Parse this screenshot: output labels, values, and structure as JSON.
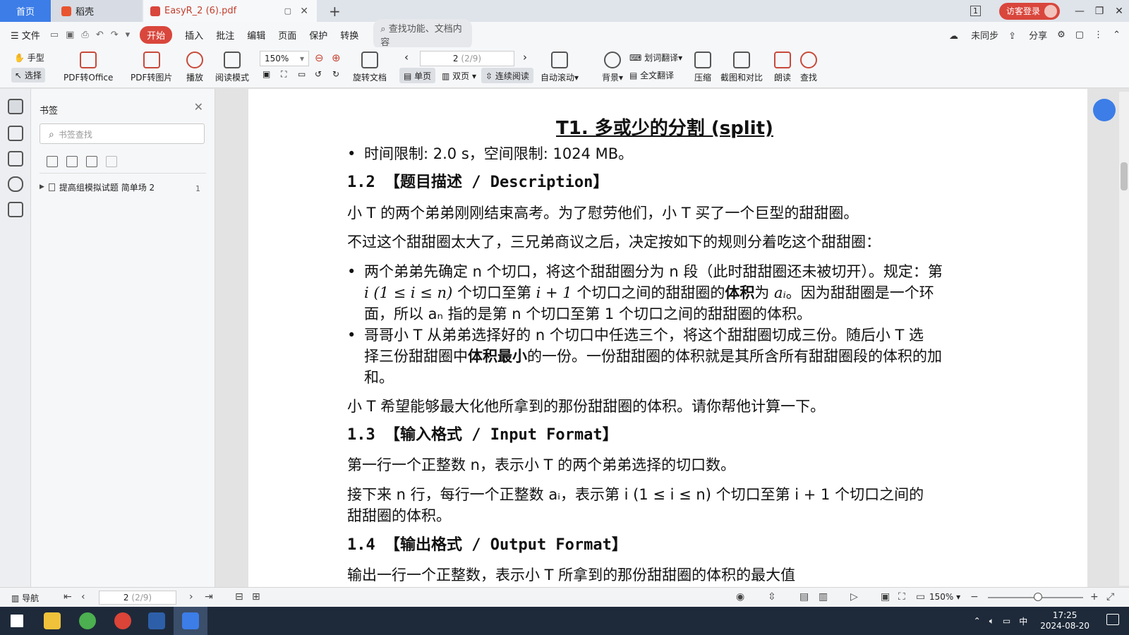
{
  "tabs": {
    "home": "首页",
    "daoke": "稻壳",
    "pdf": "EasyR_2 (6).pdf",
    "new_tab": "+"
  },
  "window": {
    "tab_count": "1",
    "login": "访客登录",
    "minimize": "—",
    "restore": "❐",
    "close": "✕"
  },
  "menu": {
    "file": "文件",
    "items": [
      "开始",
      "插入",
      "批注",
      "编辑",
      "页面",
      "保护",
      "转换"
    ],
    "search": "查找功能、文档内容",
    "sync": "未同步",
    "share": "分享"
  },
  "ribbon": {
    "hand": "手型",
    "select": "选择",
    "pdf_to_office": "PDF转Office",
    "pdf_to_image": "PDF转图片",
    "play": "播放",
    "read_mode": "阅读模式",
    "zoom": "150%",
    "page_current": "2",
    "page_total": "(2/9)",
    "rotate": "旋转文档",
    "single": "单页",
    "double": "双页",
    "continuous": "连续阅读",
    "auto_scroll": "自动滚动",
    "background": "背景",
    "word_translate": "划词翻译",
    "full_translate": "全文翻译",
    "compress": "压缩",
    "screenshot_compare": "截图和对比",
    "read_aloud": "朗读",
    "find": "查找"
  },
  "bookmarks": {
    "title": "书签",
    "search_placeholder": "书签查找",
    "items": [
      {
        "label": "提高组模拟试题 简单场 2",
        "page": "1"
      }
    ]
  },
  "document": {
    "title": "T1. 多或少的分割 (split)",
    "limits": "时间限制: 2.0 s，空间限制: 1024 MB。",
    "h_desc": "1.2 【题目描述 / Description】",
    "p1": "小 T 的两个弟弟刚刚结束高考。为了慰劳他们，小 T 买了一个巨型的甜甜圈。",
    "p2": "不过这个甜甜圈太大了，三兄弟商议之后，决定按如下的规则分着吃这个甜甜圈：",
    "b1_l1": "两个弟弟先确定 n 个切口，将这个甜甜圈分为 n 段（此时甜甜圈还未被切开）。规定：第",
    "b1_l2_math": "i (1 ≤ i ≤ n)",
    "b1_l2_a": " 个切口至第 ",
    "b1_l2_math2": "i + 1",
    "b1_l2_b": " 个切口之间的甜甜圈的",
    "b1_l2_bold": "体积",
    "b1_l2_c": "为 ",
    "b1_l2_ai": "aᵢ",
    "b1_l2_d": "。因为甜甜圈是一个环",
    "b1_l3": "面，所以 aₙ 指的是第 n 个切口至第 1 个切口之间的甜甜圈的体积。",
    "b2_l1": "哥哥小 T 从弟弟选择好的 n 个切口中任选三个，将这个甜甜圈切成三份。随后小 T 选",
    "b2_l2_a": "择三份甜甜圈中",
    "b2_l2_bold": "体积最小",
    "b2_l2_b": "的一份。一份甜甜圈的体积就是其所含所有甜甜圈段的体积的加",
    "b2_l3": "和。",
    "p3": "小 T 希望能够最大化他所拿到的那份甜甜圈的体积。请你帮他计算一下。",
    "h_input": "1.3 【输入格式 / Input Format】",
    "p4": "第一行一个正整数 n，表示小 T 的两个弟弟选择的切口数。",
    "p5_l1": "接下来 n 行，每行一个正整数 aᵢ，表示第 i (1 ≤ i ≤ n) 个切口至第 i + 1 个切口之间的",
    "p5_l2": "甜甜圈的体积。",
    "h_output": "1.4 【输出格式 / Output Format】",
    "p6_partial": "输出一行一个正整数，表示小 T 所拿到的那份甜甜圈的体积的最大值"
  },
  "status": {
    "nav": "导航",
    "page_current": "2",
    "page_total": "(2/9)",
    "zoom": "150%"
  },
  "taskbar": {
    "ime": "中",
    "time": "17:25",
    "date": "2024-08-20"
  },
  "colors": {
    "accent_blue": "#3c7de8",
    "accent_red": "#d9463c"
  }
}
